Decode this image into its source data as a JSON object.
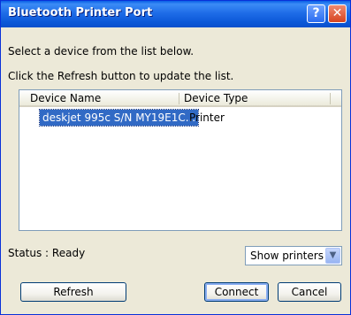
{
  "window": {
    "title": "Bluetooth Printer Port"
  },
  "instructions": {
    "line1": "Select a device from the list below.",
    "line2": "Click the Refresh button to update the list."
  },
  "list": {
    "columns": [
      "Device Name",
      "Device Type"
    ],
    "rows": [
      {
        "name": "deskjet 995c S/N MY19E1C...",
        "type": "Printer",
        "selected": true
      }
    ]
  },
  "status": {
    "label": "Status : Ready"
  },
  "filter": {
    "selected": "Show printers"
  },
  "buttons": {
    "refresh": "Refresh",
    "connect": "Connect",
    "cancel": "Cancel"
  },
  "titlebar_buttons": {
    "help": "?",
    "close": "✕"
  },
  "colors": {
    "titlebar": "#0a5fe6",
    "selection": "#316ac5",
    "dialog_bg": "#ece9d8"
  }
}
